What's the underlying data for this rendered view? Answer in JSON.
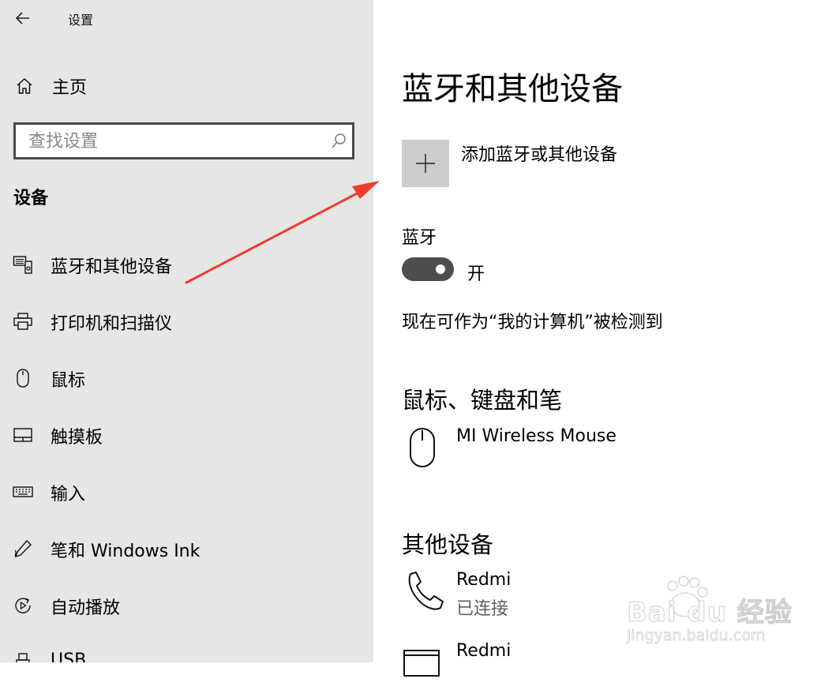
{
  "window": {
    "title": "设置"
  },
  "sidebar": {
    "home_label": "主页",
    "search_placeholder": "查找设置",
    "section_title": "设备",
    "items": [
      {
        "label": "蓝牙和其他设备",
        "icon": "bluetooth-devices-icon"
      },
      {
        "label": "打印机和扫描仪",
        "icon": "printer-icon"
      },
      {
        "label": "鼠标",
        "icon": "mouse-icon"
      },
      {
        "label": "触摸板",
        "icon": "touchpad-icon"
      },
      {
        "label": "输入",
        "icon": "keyboard-icon"
      },
      {
        "label": "笔和 Windows Ink",
        "icon": "pen-icon"
      },
      {
        "label": "自动播放",
        "icon": "autoplay-icon"
      },
      {
        "label": "USB",
        "icon": "usb-icon"
      }
    ]
  },
  "main": {
    "title": "蓝牙和其他设备",
    "add_device_label": "添加蓝牙或其他设备",
    "bluetooth": {
      "heading": "蓝牙",
      "state_label": "开",
      "is_on": true,
      "discoverable_text": "现在可作为“我的计算机”被检测到"
    },
    "mouse_group": {
      "title": "鼠标、键盘和笔",
      "devices": [
        {
          "name": "MI Wireless Mouse",
          "icon": "mouse-icon"
        }
      ]
    },
    "other_group": {
      "title": "其他设备",
      "devices": [
        {
          "name": "Redmi",
          "status": "已连接",
          "icon": "phone-icon"
        },
        {
          "name": "Redmi",
          "status": "",
          "icon": "computer-icon"
        }
      ]
    }
  },
  "overlay": {
    "arrow_color": "#f03b2f",
    "watermark_brand": "Bai du 经验",
    "watermark_url": "jingyan.baidu.com"
  },
  "colors": {
    "sidebar_bg": "#e6e6e6",
    "toggle_on": "#4d4d4d",
    "add_button_bg": "#cccccc"
  }
}
